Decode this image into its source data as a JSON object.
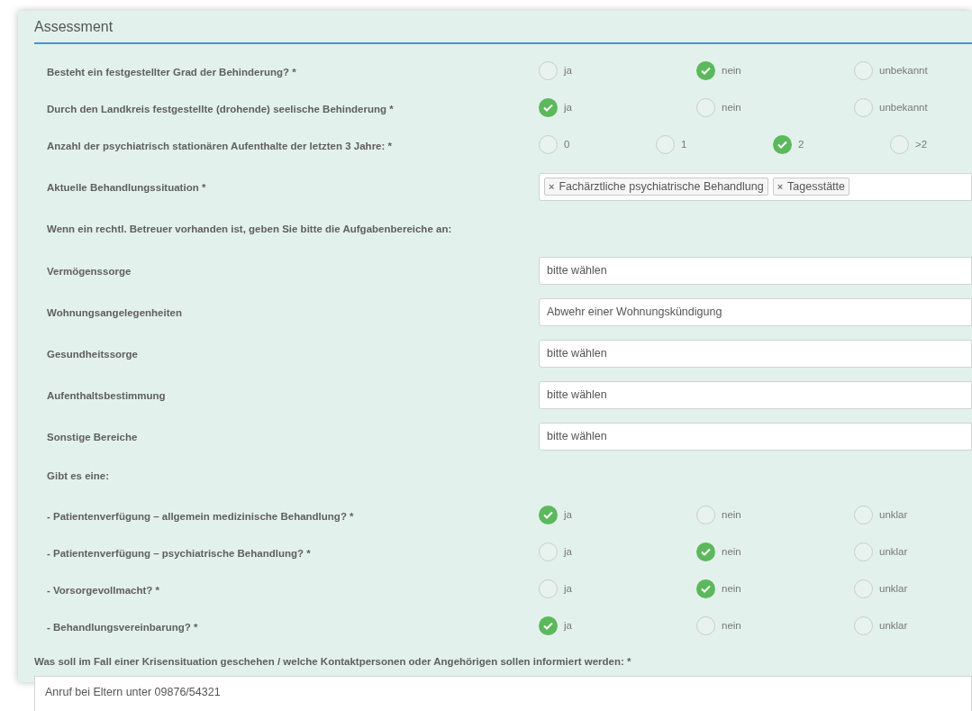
{
  "section": {
    "title": "Assessment"
  },
  "items": [
    {
      "kind": "radio",
      "label": "Besteht ein festgestellter Grad der Behinderung? *",
      "options": [
        {
          "label": "ja",
          "selected": false
        },
        {
          "label": "nein",
          "selected": true
        },
        {
          "label": "unbekannt",
          "selected": false
        }
      ]
    },
    {
      "kind": "radio",
      "label": "Durch den Landkreis festgestellte (drohende) seelische Behinderung *",
      "options": [
        {
          "label": "ja",
          "selected": true
        },
        {
          "label": "nein",
          "selected": false
        },
        {
          "label": "unbekannt",
          "selected": false
        }
      ]
    },
    {
      "kind": "radio",
      "label": "Anzahl der psychiatrisch stationären Aufenthalte der letzten 3 Jahre: *",
      "options": [
        {
          "label": "0",
          "selected": false
        },
        {
          "label": "1",
          "selected": false
        },
        {
          "label": "2",
          "selected": true
        },
        {
          "label": ">2",
          "selected": false
        }
      ]
    },
    {
      "kind": "tags",
      "label": "Aktuelle Behandlungssituation *",
      "tags": [
        {
          "remove": "×",
          "label": "Fachärztliche psychiatrische Behandlung"
        },
        {
          "remove": "×",
          "label": "Tagesstätte"
        }
      ]
    },
    {
      "kind": "heading",
      "label": "Wenn ein rechtl. Betreuer vorhanden ist, geben Sie bitte die Aufgabenbereiche an:"
    },
    {
      "kind": "select",
      "label": "Vermögenssorge",
      "value": "bitte wählen"
    },
    {
      "kind": "select",
      "label": "Wohnungsangelegenheiten",
      "value": "Abwehr einer Wohnungskündigung"
    },
    {
      "kind": "select",
      "label": "Gesundheitssorge",
      "value": "bitte wählen"
    },
    {
      "kind": "select",
      "label": "Aufenthaltsbestimmung",
      "value": "bitte wählen"
    },
    {
      "kind": "select",
      "label": "Sonstige Bereiche",
      "value": "bitte wählen"
    },
    {
      "kind": "heading",
      "label": "Gibt es eine:"
    },
    {
      "kind": "radio",
      "label": "- Patientenverfügung – allgemein medizinische Behandlung? *",
      "options": [
        {
          "label": "ja",
          "selected": true
        },
        {
          "label": "nein",
          "selected": false
        },
        {
          "label": "unklar",
          "selected": false
        }
      ]
    },
    {
      "kind": "radio",
      "label": "- Patientenverfügung – psychiatrische Behandlung? *",
      "options": [
        {
          "label": "ja",
          "selected": false
        },
        {
          "label": "nein",
          "selected": true
        },
        {
          "label": "unklar",
          "selected": false
        }
      ]
    },
    {
      "kind": "radio",
      "label": "- Vorsorgevollmacht? *",
      "options": [
        {
          "label": "ja",
          "selected": false
        },
        {
          "label": "nein",
          "selected": true
        },
        {
          "label": "unklar",
          "selected": false
        }
      ]
    },
    {
      "kind": "radio",
      "label": "- Behandlungsvereinbarung? *",
      "options": [
        {
          "label": "ja",
          "selected": true
        },
        {
          "label": "nein",
          "selected": false
        },
        {
          "label": "unklar",
          "selected": false
        }
      ]
    }
  ],
  "crisis": {
    "label": "Was soll im Fall einer Krisensituation geschehen / welche Kontaktpersonen oder Angehörigen sollen informiert werden: *",
    "value": "Anruf bei Eltern unter 09876/54321"
  }
}
